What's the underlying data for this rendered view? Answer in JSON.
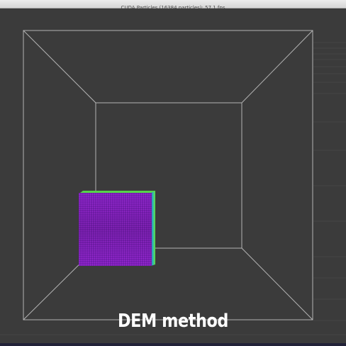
{
  "window": {
    "title": "CUDA Particles (16384 particles): 57.1 fps"
  },
  "caption": "DEM method",
  "colors": {
    "background": "#3b3b3b",
    "wireframe": "#c8c8c8",
    "particles_primary": "#8a1fc4",
    "particles_edge": "#3fd24a",
    "caption": "#ffffff"
  },
  "icons": [
    "bounding-box-wireframe",
    "particle-block"
  ]
}
